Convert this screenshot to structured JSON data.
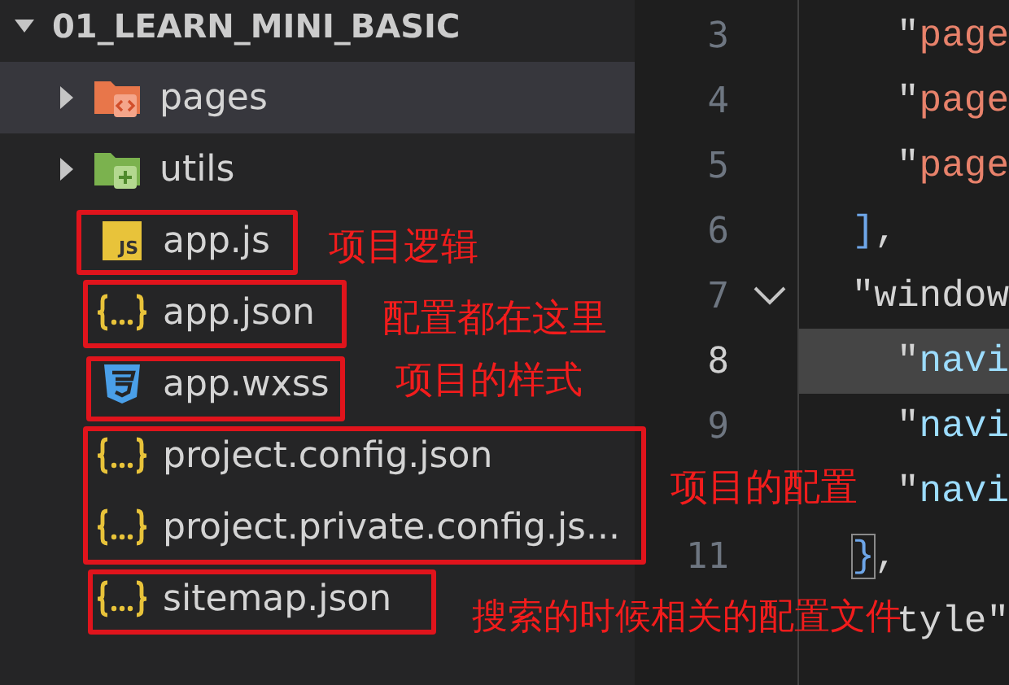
{
  "explorer": {
    "root": {
      "label": "01_LEARN_MINI_BASIC",
      "expanded": true
    },
    "items": [
      {
        "label": "pages",
        "kind": "folder",
        "expanded": false,
        "selected": true
      },
      {
        "label": "utils",
        "kind": "folder",
        "expanded": false,
        "selected": false
      },
      {
        "label": "app.js",
        "kind": "file",
        "badge": "JS",
        "selected": false
      },
      {
        "label": "app.json",
        "kind": "file",
        "selected": false
      },
      {
        "label": "app.wxss",
        "kind": "file",
        "selected": false
      },
      {
        "label": "project.config.json",
        "kind": "file",
        "selected": false
      },
      {
        "label": "project.private.config.js...",
        "kind": "file",
        "selected": false
      },
      {
        "label": "sitemap.json",
        "kind": "file",
        "selected": false
      }
    ]
  },
  "editor": {
    "lines": [
      {
        "number": "3",
        "current": false,
        "fold": false,
        "tokens": [
          {
            "kind": "punct",
            "text": "\""
          },
          {
            "kind": "string",
            "text": "page"
          }
        ]
      },
      {
        "number": "4",
        "current": false,
        "fold": false,
        "tokens": [
          {
            "kind": "punct",
            "text": "\""
          },
          {
            "kind": "string",
            "text": "page"
          }
        ]
      },
      {
        "number": "5",
        "current": false,
        "fold": false,
        "tokens": [
          {
            "kind": "punct",
            "text": "\""
          },
          {
            "kind": "string",
            "text": "page"
          }
        ]
      },
      {
        "number": "6",
        "current": false,
        "fold": false,
        "tokens": [
          {
            "kind": "bracket",
            "text": "]"
          },
          {
            "kind": "punct",
            "text": ","
          }
        ]
      },
      {
        "number": "7",
        "current": false,
        "fold": true,
        "tokens": [
          {
            "kind": "plain",
            "text": "\"window"
          }
        ]
      },
      {
        "number": "8",
        "current": true,
        "fold": false,
        "tokens": [
          {
            "kind": "punct",
            "text": "\""
          },
          {
            "kind": "key",
            "text": "navi"
          }
        ]
      },
      {
        "number": "9",
        "current": false,
        "fold": false,
        "tokens": [
          {
            "kind": "punct",
            "text": "\""
          },
          {
            "kind": "key",
            "text": "navi"
          }
        ]
      },
      {
        "current": false,
        "fold": false,
        "tokens": [
          {
            "kind": "punct",
            "text": "\""
          },
          {
            "kind": "key",
            "text": "navi"
          }
        ]
      },
      {
        "number": "11",
        "current": false,
        "fold": false,
        "tokens": [
          {
            "kind": "match",
            "text": "}"
          },
          {
            "kind": "punct",
            "text": ","
          }
        ]
      },
      {
        "current": false,
        "fold": false,
        "tokens": [
          {
            "kind": "plain",
            "text": "tyle\""
          }
        ]
      }
    ]
  },
  "annotations": [
    {
      "text": "项目逻辑"
    },
    {
      "text": "配置都在这里"
    },
    {
      "text": "项目的样式"
    },
    {
      "text": "项目的配置"
    },
    {
      "text": "搜索的时候相关的配置文件"
    }
  ]
}
